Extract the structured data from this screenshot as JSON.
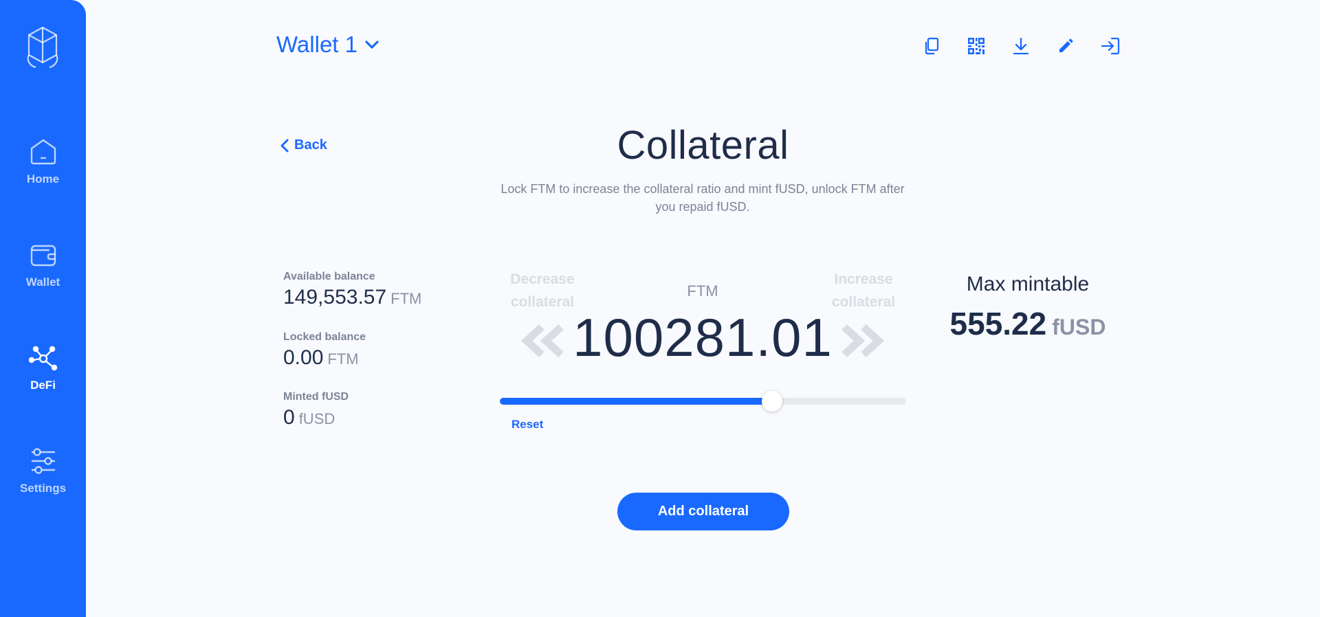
{
  "theme": {
    "accent": "#1969ff",
    "text": "#1f2d4a",
    "muted": "#7b8397",
    "background": "#f9fafd"
  },
  "sidebar": {
    "logo_icon": "fantom-logo-icon",
    "items": [
      {
        "label": "Home",
        "icon": "home-icon",
        "active": false
      },
      {
        "label": "Wallet",
        "icon": "wallet-icon",
        "active": false
      },
      {
        "label": "DeFi",
        "icon": "network-icon",
        "active": true
      },
      {
        "label": "Settings",
        "icon": "sliders-icon",
        "active": false
      }
    ]
  },
  "header": {
    "wallet_name": "Wallet 1",
    "toolbar_icons": [
      "copy-icon",
      "qr-code-icon",
      "download-icon",
      "edit-icon",
      "logout-icon"
    ]
  },
  "page": {
    "back_label": "Back",
    "title": "Collateral",
    "description": "Lock FTM to increase the collateral ratio and mint fUSD, unlock FTM after you repaid fUSD."
  },
  "balances": {
    "available": {
      "label": "Available balance",
      "value": "149,553.57",
      "unit": "FTM"
    },
    "locked": {
      "label": "Locked balance",
      "value": "0.00",
      "unit": "FTM"
    },
    "minted": {
      "label": "Minted fUSD",
      "value": "0",
      "unit": "fUSD"
    }
  },
  "collateral": {
    "decrease_label": "Decrease collateral",
    "increase_label": "Increase collateral",
    "unit": "FTM",
    "amount": "100281.01",
    "slider_fraction": 0.67,
    "reset_label": "Reset"
  },
  "max_mintable": {
    "label": "Max mintable",
    "value": "555.22",
    "unit": "fUSD"
  },
  "actions": {
    "add_collateral_label": "Add collateral"
  }
}
